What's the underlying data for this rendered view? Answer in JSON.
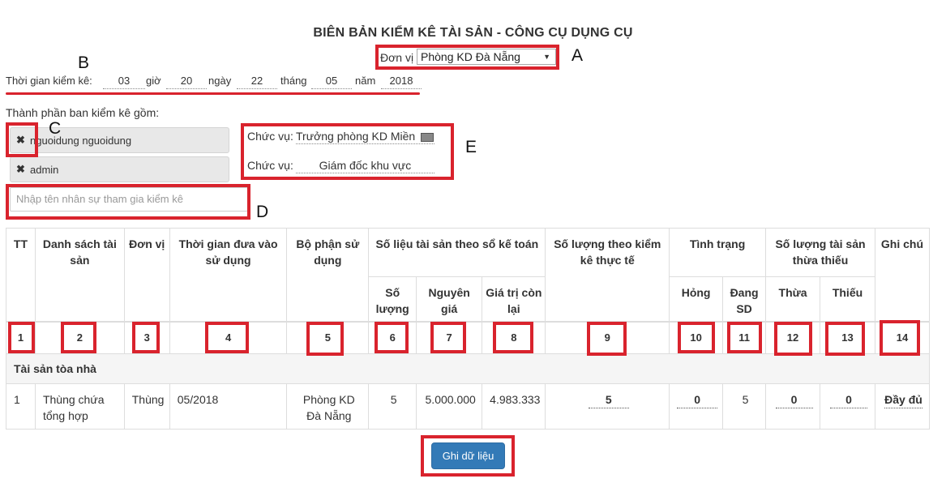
{
  "title": "BIÊN BẢN KIỂM KÊ TÀI SẢN - CÔNG CỤ DỤNG CỤ",
  "unit": {
    "label": "Đơn vị",
    "selected": "Phòng KD Đà Nẵng"
  },
  "inventory_time": {
    "label": "Thời gian kiểm kê:",
    "hour_label": "giờ",
    "day_label": "ngày",
    "month_label": "tháng",
    "year_label": "năm",
    "minute": "03",
    "hour": "20",
    "day": "22",
    "month": "05",
    "year": "2018"
  },
  "members": {
    "label": "Thành phần ban kiểm kê gồm:",
    "items": [
      {
        "name": "nguoidung nguoidung",
        "remove": "✖"
      },
      {
        "name": "admin",
        "remove": "✖"
      }
    ],
    "input_placeholder": "Nhập tên nhân sự tham gia kiểm kê"
  },
  "positions": [
    {
      "label": "Chức vụ:",
      "value": "Trưởng phòng KD Miền"
    },
    {
      "label": "Chức vụ:",
      "value": "Giám đốc khu vực"
    }
  ],
  "annotations": {
    "a": "A",
    "b": "B",
    "c": "C",
    "d": "D",
    "e": "E"
  },
  "table": {
    "headers": {
      "tt": "TT",
      "asset_list": "Danh sách tài sản",
      "unit": "Đơn vị",
      "use_time": "Thời gian đưa vào sử dụng",
      "department": "Bộ phận sử dụng",
      "book_data": "Số liệu tài sản theo sổ kế toán",
      "book_qty": "Số lượng",
      "book_cost": "Nguyên giá",
      "book_remaining": "Giá trị còn lại",
      "actual_qty": "Số lượng theo kiểm kê thực tế",
      "status": "Tình trạng",
      "broken": "Hỏng",
      "in_use": "Đang SD",
      "surplus_deficit": "Số lượng tài sản thừa thiếu",
      "surplus": "Thừa",
      "deficit": "Thiếu",
      "note": "Ghi chú"
    },
    "column_numbers": [
      "1",
      "2",
      "3",
      "4",
      "5",
      "6",
      "7",
      "8",
      "9",
      "10",
      "11",
      "12",
      "13",
      "14"
    ],
    "group": "Tài sản tòa nhà",
    "rows": [
      {
        "tt": "1",
        "asset": "Thùng chứa tổng hợp",
        "unit": "Thùng",
        "use_time": "05/2018",
        "department": "Phòng KD Đà Nẵng",
        "book_qty": "5",
        "book_cost": "5.000.000",
        "book_remaining": "4.983.333",
        "actual_qty": "5",
        "broken": "0",
        "in_use": "5",
        "surplus": "0",
        "deficit": "0",
        "note": "Đầy đủ"
      }
    ]
  },
  "save_button": "Ghi dữ liệu",
  "colors": {
    "highlight": "#d9232d",
    "primary_button": "#337ab7"
  }
}
